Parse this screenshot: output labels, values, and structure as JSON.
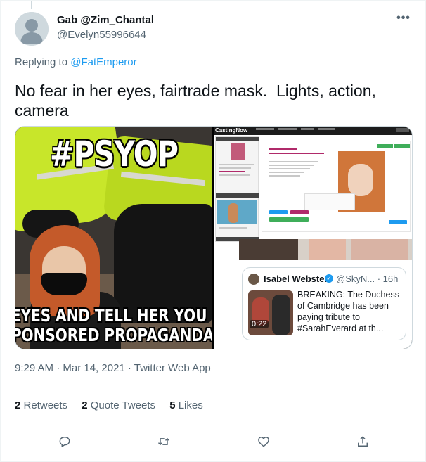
{
  "tweet": {
    "display_name": "Gab @Zim_Chantal",
    "handle": "@Evelyn55996644",
    "more_label": "•••",
    "replying_prefix": "Replying to ",
    "replying_to": "@FatEmperor",
    "text": "No fear in her eyes, fairtrade mask.  Lights, action, camera",
    "timestamp": "9:29 AM · Mar 14, 2021 · Twitter Web App"
  },
  "media": {
    "left_image": {
      "top_caption": "#PSYOP",
      "bottom_caption_line1": "EYES AND TELL HER YOU",
      "bottom_caption_line2": "PONSORED PROPAGANDA"
    },
    "right_image": {
      "site_logo": "CastingNow",
      "embedded_tweet": {
        "name": "Isabel Webster",
        "handle": "@SkyN... · 16h",
        "duration": "0:22",
        "text": "BREAKING: The Duchess of Cambridge has been paying tribute to #SarahEverard at th..."
      }
    }
  },
  "stats": {
    "retweets_count": "2",
    "retweets_label": "Retweets",
    "quotes_count": "2",
    "quotes_label": "Quote Tweets",
    "likes_count": "5",
    "likes_label": "Likes"
  },
  "actions": [
    {
      "icon": "reply-icon"
    },
    {
      "icon": "retweet-icon"
    },
    {
      "icon": "like-icon"
    },
    {
      "icon": "share-icon"
    }
  ],
  "colors": {
    "accent": "#1d9bf0",
    "secondary_text": "#536471",
    "primary_text": "#0f1419"
  }
}
